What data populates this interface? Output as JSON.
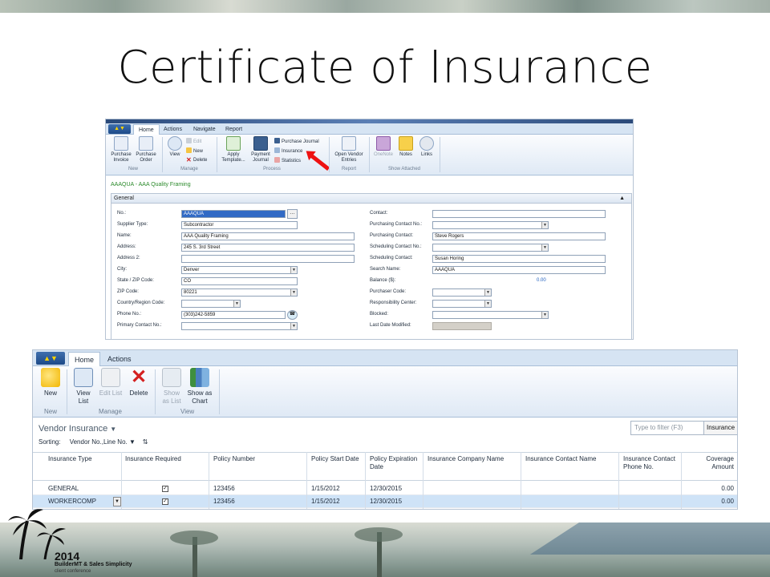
{
  "slide": {
    "title": "Certificate of Insurance"
  },
  "card": {
    "tabs": [
      "Home",
      "Actions",
      "Navigate",
      "Report"
    ],
    "ribbon": {
      "purchase_invoice": "Purchase Invoice",
      "purchase_order": "Purchase Order",
      "group_new": "New",
      "view": "View",
      "edit": "Edit",
      "new": "New",
      "delete": "Delete",
      "group_manage": "Manage",
      "apply_template": "Apply Template...",
      "payment_journal": "Payment Journal",
      "purchase_journal": "Purchase Journal",
      "insurance": "Insurance",
      "statistics": "Statistics",
      "group_process": "Process",
      "open_vendor_entries": "Open Vendor Entries",
      "group_report": "Report",
      "onenote": "OneNote",
      "notes": "Notes",
      "links": "Links",
      "group_show_attached": "Show Attached"
    },
    "record_title": "AAAQUA - AAA Quality Framing",
    "fasttab": "General",
    "left_fields": [
      {
        "label": "No.:",
        "value": "AAAQUA"
      },
      {
        "label": "Supplier Type:",
        "value": "Subcontractor"
      },
      {
        "label": "Name:",
        "value": "AAA Quality Framing"
      },
      {
        "label": "Address:",
        "value": "245 S. 3rd Street"
      },
      {
        "label": "Address 2:",
        "value": ""
      },
      {
        "label": "City:",
        "value": "Denver"
      },
      {
        "label": "State / ZIP Code:",
        "value": "CO"
      },
      {
        "label": "ZIP Code:",
        "value": "80221"
      },
      {
        "label": "Country/Region Code:",
        "value": ""
      },
      {
        "label": "Phone No.:",
        "value": "(303)242-5859"
      },
      {
        "label": "Primary Contact No.:",
        "value": ""
      }
    ],
    "right_fields": [
      {
        "label": "Contact:",
        "value": ""
      },
      {
        "label": "Purchasing Contact No.:",
        "value": ""
      },
      {
        "label": "Purchasing Contact:",
        "value": "Steve Rogers"
      },
      {
        "label": "Scheduling Contact No.:",
        "value": ""
      },
      {
        "label": "Scheduling Contact:",
        "value": "Susan Horing"
      },
      {
        "label": "Search Name:",
        "value": "AAAQUA"
      },
      {
        "label": "Balance ($):",
        "value": "0.00"
      },
      {
        "label": "Purchaser Code:",
        "value": ""
      },
      {
        "label": "Responsibility Center:",
        "value": ""
      },
      {
        "label": "Blocked:",
        "value": ""
      },
      {
        "label": "Last Date Modified:",
        "value": ""
      }
    ]
  },
  "insurance_list": {
    "tabs": [
      "Home",
      "Actions"
    ],
    "ribbon": {
      "new": "New",
      "group_new": "New",
      "view_list": "View List",
      "edit_list": "Edit List",
      "delete": "Delete",
      "group_manage": "Manage",
      "show_as_list": "Show as List",
      "show_as_chart": "Show as Chart",
      "group_view": "View"
    },
    "page_title": "Vendor Insurance",
    "filter_placeholder": "Type to filter (F3)",
    "filter_field": "Insurance",
    "sorting_label": "Sorting:",
    "sorting_value": "Vendor No.,Line No.",
    "columns": [
      "Insurance Type",
      "Insurance Required",
      "Policy Number",
      "Policy Start Date",
      "Policy Expiration Date",
      "Insurance Company Name",
      "Insurance Contact Name",
      "Insurance Contact Phone No.",
      "Coverage Amount"
    ],
    "rows": [
      {
        "type": "GENERAL",
        "required": "✓",
        "policy": "123456",
        "start": "1/15/2012",
        "expiration": "12/30/2015",
        "company": "",
        "contact": "",
        "phone": "",
        "amount": "0.00"
      },
      {
        "type": "WORKERCOMP",
        "required": "✓",
        "policy": "123456",
        "start": "1/15/2012",
        "expiration": "12/30/2015",
        "company": "",
        "contact": "",
        "phone": "",
        "amount": "0.00"
      }
    ]
  },
  "logo": {
    "year": "2014",
    "line1": "BuilderMT & Sales Simplicity",
    "line2": "client conference"
  },
  "colors": {
    "ribbon_blue": "#d6e4f3",
    "selection": "#316ac5",
    "record_green": "#2b8a2b",
    "arrow_red": "#e11111"
  }
}
